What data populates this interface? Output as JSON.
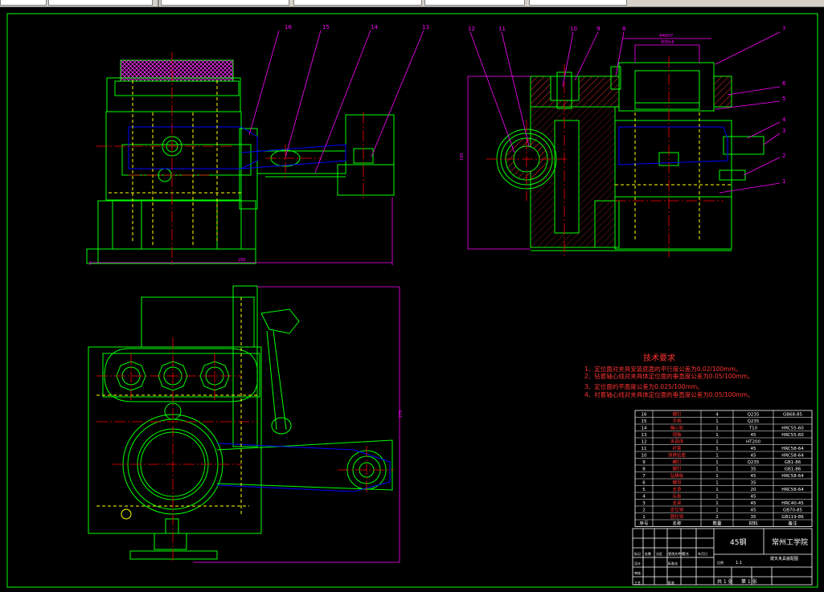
{
  "toolbar": {
    "fields": [
      "",
      "",
      "",
      "",
      "",
      ""
    ]
  },
  "drawing": {
    "tech_title": "技术要求",
    "tech_requirements": [
      "1、定位面对夹具安装底面的平行度公差为0.02/100mm。",
      "2、钻套轴心线对夹具体定位面的垂直度公差为0.05/100mm。",
      "3、定位面的平面度公差为0.025/100mm。",
      "4、衬套轴心线对夹具体定位面的垂直度公差为0.05/100mm。"
    ],
    "material": "45钢",
    "school": "常州工学院",
    "part_title": "拨叉夹具装配图",
    "scale": "1:1",
    "sheet_total": "共 1 张",
    "sheet_num": "第 1 张",
    "dim_width": "290",
    "dim_height": "273",
    "dim_side": "195",
    "dims_top": [
      "Φ40H7",
      "Φ35h6"
    ],
    "balloons_front": [
      "16",
      "15",
      "14",
      "13"
    ],
    "balloons_side": [
      "12",
      "11",
      "10",
      "9",
      "8",
      "7",
      "6",
      "5",
      "4",
      "3",
      "2",
      "1"
    ],
    "bom": [
      [
        "16",
        "螺钉",
        "4",
        "Q235",
        "GB68-85"
      ],
      [
        "15",
        "手柄",
        "1",
        "Q235",
        ""
      ],
      [
        "14",
        "偏心轮",
        "1",
        "T10",
        "HRC55-60"
      ],
      [
        "13",
        "销轴",
        "1",
        "45",
        "HRC55-60"
      ],
      [
        "12",
        "夹具体",
        "1",
        "HT200",
        ""
      ],
      [
        "11",
        "衬套",
        "1",
        "45",
        "HRC58-64"
      ],
      [
        "10",
        "快换钻套",
        "1",
        "45",
        "HRC58-64"
      ],
      [
        "9",
        "螺钉",
        "1",
        "Q235",
        "GB1-86"
      ],
      [
        "8",
        "螺钉",
        "1",
        "35",
        "GB1-86"
      ],
      [
        "7",
        "钻模板",
        "1",
        "45",
        "HRC58-64"
      ],
      [
        "6",
        "螺母",
        "1",
        "35",
        ""
      ],
      [
        "5",
        "支承",
        "1",
        "20",
        "HRC58-64"
      ],
      [
        "4",
        "压板",
        "1",
        "45",
        ""
      ],
      [
        "3",
        "支架",
        "1",
        "45",
        "HRC40-45"
      ],
      [
        "2",
        "定位销",
        "1",
        "45",
        "GB70-85"
      ],
      [
        "1",
        "圆柱销",
        "2",
        "35",
        "GB119-86"
      ]
    ],
    "bom_header": [
      "序号",
      "名称",
      "数量",
      "材料",
      "备注"
    ],
    "title_block_labels": [
      "标记",
      "处数",
      "分区",
      "更改文件号",
      "签名",
      "年月日",
      "设计",
      "标准化",
      "审核",
      "工艺",
      "批准",
      "比例"
    ]
  },
  "colors": {
    "frame": "#00ff00",
    "outline": "#00ff00",
    "leader": "#ff00ff",
    "center": "#ff0000",
    "hidden": "#ffff00",
    "blue": "#0000ff",
    "white": "#ffffff",
    "text_red": "#ff3333"
  }
}
